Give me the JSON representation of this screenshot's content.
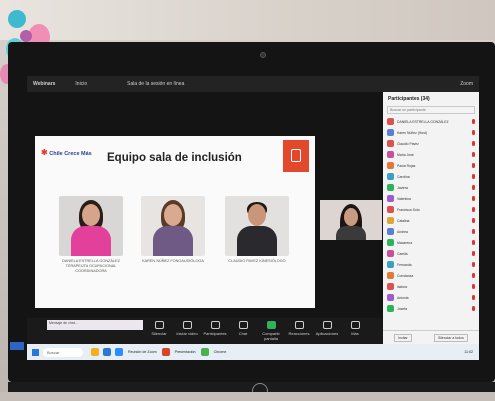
{
  "window": {
    "app_name": "Webinars",
    "tab_home": "Inicio",
    "meeting_tab": "Sala de la sesión en línea",
    "corner_label": "Zoom"
  },
  "slide": {
    "logo_text": "Chile Crece Más",
    "title": "Equipo sala de inclusión",
    "members": [
      {
        "caption": "DANIELA ESTRELLA GONZÁLEZ TERAPEUTA OCUPACIONAL COORDINADORA"
      },
      {
        "caption": "KAREN NÚÑEZ FONOAUDIÓLOGA"
      },
      {
        "caption": "CLAUDIO PAVEZ KINESIÓLOGO"
      }
    ]
  },
  "controls": [
    {
      "label": "Silenciar",
      "icon": "microphone-icon"
    },
    {
      "label": "Iniciar video",
      "icon": "video-icon"
    },
    {
      "label": "Participantes",
      "icon": "participants-icon"
    },
    {
      "label": "Chat",
      "icon": "chat-icon"
    },
    {
      "label": "Compartir pantalla",
      "icon": "share-screen-icon"
    },
    {
      "label": "Reacciones",
      "icon": "reactions-icon"
    },
    {
      "label": "Aplicaciones",
      "icon": "apps-icon"
    },
    {
      "label": "Más",
      "icon": "more-icon"
    }
  ],
  "chat_preview": "Mensaje de chat...",
  "participants_panel": {
    "title": "Participantes (34)",
    "search_placeholder": "Buscar un participante",
    "participants": [
      {
        "name": "DANIELA ESTRELLA GONZÁLEZ",
        "color": "#d9534f"
      },
      {
        "name": "Karen Núñez (Host)",
        "color": "#5b7fd1"
      },
      {
        "name": "Claudio Pavez",
        "color": "#d9534f"
      },
      {
        "name": "María José",
        "color": "#c94f9b"
      },
      {
        "name": "Paula Rojas",
        "color": "#e07a3b"
      },
      {
        "name": "Carolina",
        "color": "#3aa0c4"
      },
      {
        "name": "Javiera",
        "color": "#2db35a"
      },
      {
        "name": "Valentina",
        "color": "#9c5bd1"
      },
      {
        "name": "Francisca Soto",
        "color": "#d9534f"
      },
      {
        "name": "Catalina",
        "color": "#e0a43b"
      },
      {
        "name": "Andrea",
        "color": "#5b7fd1"
      },
      {
        "name": "Macarena",
        "color": "#2db35a"
      },
      {
        "name": "Camila",
        "color": "#c94f9b"
      },
      {
        "name": "Fernanda",
        "color": "#3aa0c4"
      },
      {
        "name": "Constanza",
        "color": "#e07a3b"
      },
      {
        "name": "Isidora",
        "color": "#d9534f"
      },
      {
        "name": "Antonia",
        "color": "#9c5bd1"
      },
      {
        "name": "Josefa",
        "color": "#2db35a"
      }
    ],
    "invite_label": "Invitar",
    "mute_all_label": "Silenciar a todos"
  },
  "taskbar": {
    "search_placeholder": "Buscar",
    "open_windows": [
      "Reunión de Zoom",
      "Presentación",
      "Chrome"
    ],
    "time": "11:02"
  }
}
